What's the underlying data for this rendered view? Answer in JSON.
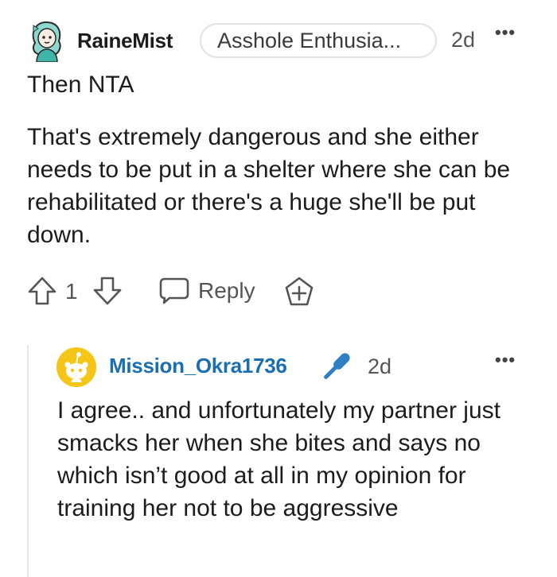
{
  "comment": {
    "username": "RaineMist",
    "flair": "Asshole Enthusia...",
    "time": "2d",
    "more": "•••",
    "line1": "Then NTA",
    "body": "That's extremely dangerous and she either needs to be put in a shelter where she can be rehabilitated or there's a huge she'll be put down.",
    "vote_count": "1",
    "reply_label": "Reply"
  },
  "reply": {
    "username": "Mission_Okra1736",
    "time": "2d",
    "more": "•••",
    "body": "I agree.. and unfortunately my partner just smacks her when she bites and says no which isn’t good at all in my opinion for training her not to be aggressive"
  },
  "colors": {
    "username_link": "#1a6fb3",
    "mic_blue": "#2f7fc4",
    "avatar_gold": "#f5c518",
    "avatar_teal": "#6fd1c8"
  }
}
